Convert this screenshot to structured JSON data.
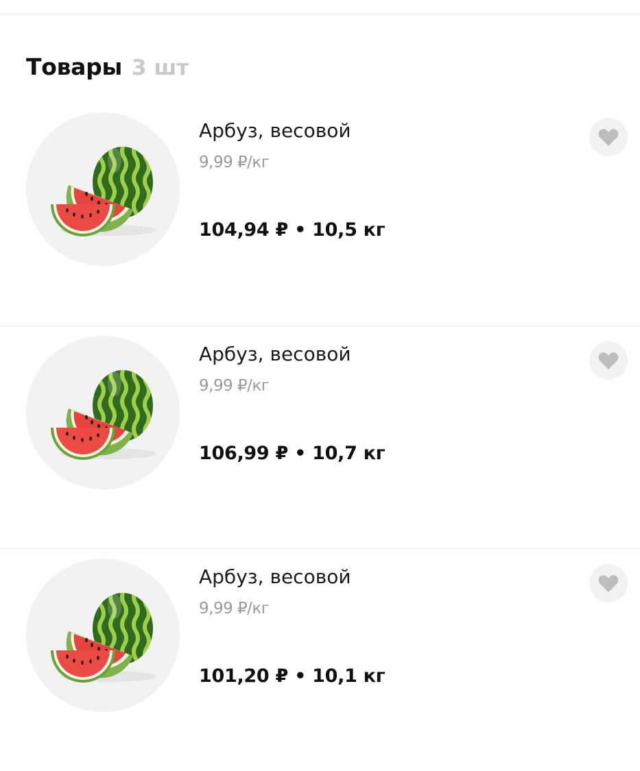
{
  "section": {
    "title": "Товары",
    "count": "3 шт"
  },
  "colors": {
    "heart": "#bdbdbd",
    "image_bg": "#f2f2f2",
    "muted_text": "#9a9a9a",
    "divider": "#ebebeb"
  },
  "products": [
    {
      "name": "Арбуз, весовой",
      "unit_price": "9,99 ₽/кг",
      "total": "104,94 ₽ • 10,5 кг",
      "image_icon": "watermelon-image",
      "favorite_icon": "heart-icon"
    },
    {
      "name": "Арбуз, весовой",
      "unit_price": "9,99 ₽/кг",
      "total": "106,99 ₽ • 10,7 кг",
      "image_icon": "watermelon-image",
      "favorite_icon": "heart-icon"
    },
    {
      "name": "Арбуз, весовой",
      "unit_price": "9,99 ₽/кг",
      "total": "101,20 ₽ • 10,1 кг",
      "image_icon": "watermelon-image",
      "favorite_icon": "heart-icon"
    }
  ]
}
